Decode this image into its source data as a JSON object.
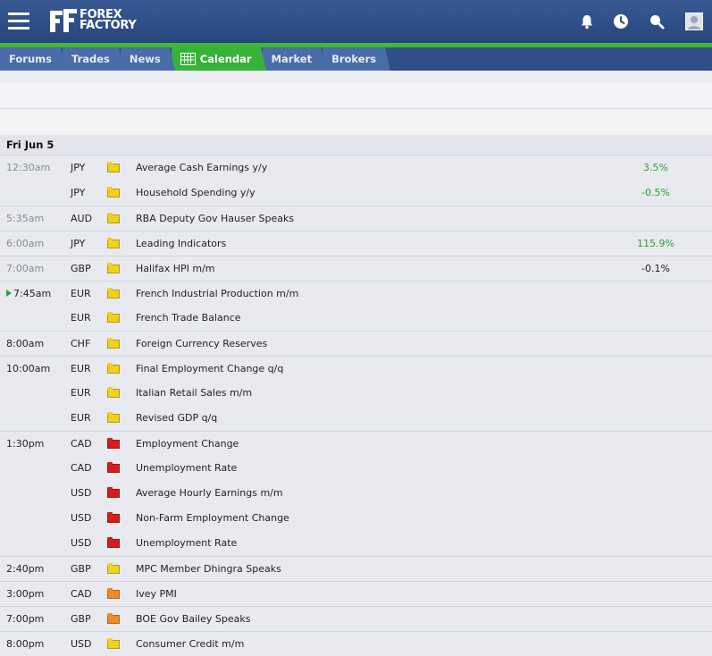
{
  "site": {
    "brand_line1": "FOREX",
    "brand_line2": "FACTORY"
  },
  "icons": {
    "menu": "hamburger-menu-icon",
    "notifications": "bell-icon",
    "history": "clock-icon",
    "search": "search-icon",
    "account": "user-avatar-icon",
    "calendar": "calendar-icon"
  },
  "colors": {
    "topbar": "#2f4f86",
    "accent_green": "#37b23a",
    "impact_low": "#f2d01e",
    "impact_medium": "#ee8a2b",
    "impact_high": "#d41d1d",
    "positive_value": "#2aa132"
  },
  "nav": {
    "tabs": [
      {
        "label": "Forums",
        "active": false
      },
      {
        "label": "Trades",
        "active": false
      },
      {
        "label": "News",
        "active": false
      },
      {
        "label": "Calendar",
        "active": true
      },
      {
        "label": "Market",
        "active": false
      },
      {
        "label": "Brokers",
        "active": false
      }
    ]
  },
  "calendar": {
    "day_label": "Fri Jun 5",
    "events": [
      {
        "time": "12:30am",
        "past": true,
        "currency": "JPY",
        "impact": "low",
        "title": "Average Cash Earnings y/y",
        "value": "3.5%",
        "value_color": "green"
      },
      {
        "time": "",
        "past": true,
        "currency": "JPY",
        "impact": "low",
        "title": "Household Spending y/y",
        "value": "-0.5%",
        "value_color": "green"
      },
      {
        "time": "5:35am",
        "past": true,
        "currency": "AUD",
        "impact": "low",
        "title": "RBA Deputy Gov Hauser Speaks",
        "value": "",
        "value_color": ""
      },
      {
        "time": "6:00am",
        "past": true,
        "currency": "JPY",
        "impact": "low",
        "title": "Leading Indicators",
        "value": "115.9%",
        "value_color": "green"
      },
      {
        "time": "7:00am",
        "past": true,
        "currency": "GBP",
        "impact": "low",
        "title": "Halifax HPI m/m",
        "value": "-0.1%",
        "value_color": "black"
      },
      {
        "time": "7:45am",
        "past": false,
        "now": true,
        "currency": "EUR",
        "impact": "low",
        "title": "French Industrial Production m/m",
        "value": "",
        "value_color": ""
      },
      {
        "time": "",
        "past": false,
        "currency": "EUR",
        "impact": "low",
        "title": "French Trade Balance",
        "value": "",
        "value_color": ""
      },
      {
        "time": "8:00am",
        "past": false,
        "currency": "CHF",
        "impact": "low",
        "title": "Foreign Currency Reserves",
        "value": "",
        "value_color": ""
      },
      {
        "time": "10:00am",
        "past": false,
        "currency": "EUR",
        "impact": "low",
        "title": "Final Employment Change q/q",
        "value": "",
        "value_color": ""
      },
      {
        "time": "",
        "past": false,
        "currency": "EUR",
        "impact": "low",
        "title": "Italian Retail Sales m/m",
        "value": "",
        "value_color": ""
      },
      {
        "time": "",
        "past": false,
        "currency": "EUR",
        "impact": "low",
        "title": "Revised GDP q/q",
        "value": "",
        "value_color": ""
      },
      {
        "time": "1:30pm",
        "past": false,
        "currency": "CAD",
        "impact": "high",
        "title": "Employment Change",
        "value": "",
        "value_color": ""
      },
      {
        "time": "",
        "past": false,
        "currency": "CAD",
        "impact": "high",
        "title": "Unemployment Rate",
        "value": "",
        "value_color": ""
      },
      {
        "time": "",
        "past": false,
        "currency": "USD",
        "impact": "high",
        "title": "Average Hourly Earnings m/m",
        "value": "",
        "value_color": ""
      },
      {
        "time": "",
        "past": false,
        "currency": "USD",
        "impact": "high",
        "title": "Non-Farm Employment Change",
        "value": "",
        "value_color": ""
      },
      {
        "time": "",
        "past": false,
        "currency": "USD",
        "impact": "high",
        "title": "Unemployment Rate",
        "value": "",
        "value_color": ""
      },
      {
        "time": "2:40pm",
        "past": false,
        "currency": "GBP",
        "impact": "low",
        "title": "MPC Member Dhingra Speaks",
        "value": "",
        "value_color": ""
      },
      {
        "time": "3:00pm",
        "past": false,
        "currency": "CAD",
        "impact": "medium",
        "title": "Ivey PMI",
        "value": "",
        "value_color": ""
      },
      {
        "time": "7:00pm",
        "past": false,
        "currency": "GBP",
        "impact": "medium",
        "title": "BOE Gov Bailey Speaks",
        "value": "",
        "value_color": ""
      },
      {
        "time": "8:00pm",
        "past": false,
        "currency": "USD",
        "impact": "low",
        "title": "Consumer Credit m/m",
        "value": "",
        "value_color": ""
      }
    ]
  }
}
